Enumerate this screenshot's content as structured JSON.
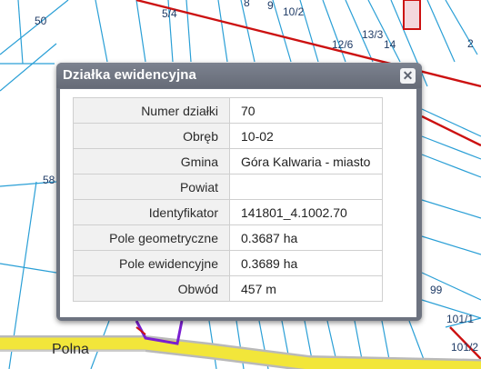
{
  "map": {
    "plot_numbers": [
      "50",
      "5/4",
      "8",
      "9",
      "10/2",
      "13/3",
      "12/6",
      "14",
      "58",
      "99",
      "101/1",
      "101/2",
      "2"
    ],
    "road_name": "Polna",
    "colors": {
      "parcel_line": "#2a9fd6",
      "boundary_line": "#cc1111",
      "road_fill": "#f2e63a",
      "road_edge": "#b9b9b9",
      "selected_outline": "#7a1fd1",
      "popup_frame": "#6d7380"
    }
  },
  "popup": {
    "title": "Działka ewidencyjna",
    "close_glyph": "✕",
    "rows": [
      {
        "label": "Numer działki",
        "value": "70"
      },
      {
        "label": "Obręb",
        "value": "10-02"
      },
      {
        "label": "Gmina",
        "value": "Góra Kalwaria - miasto"
      },
      {
        "label": "Powiat",
        "value": ""
      },
      {
        "label": "Identyfikator",
        "value": "141801_4.1002.70"
      },
      {
        "label": "Pole geometryczne",
        "value": "0.3687 ha"
      },
      {
        "label": "Pole ewidencyjne",
        "value": "0.3689 ha"
      },
      {
        "label": "Obwód",
        "value": "457 m"
      }
    ]
  }
}
